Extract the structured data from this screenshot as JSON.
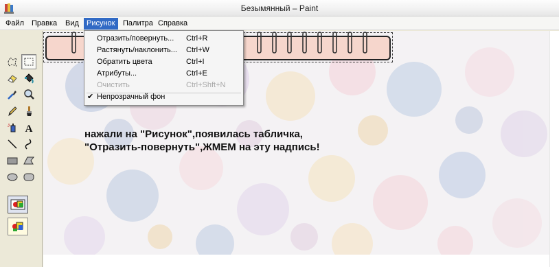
{
  "window": {
    "title": "Безымянный – Paint"
  },
  "menubar": {
    "items": [
      {
        "label": "Файл"
      },
      {
        "label": "Правка"
      },
      {
        "label": "Вид"
      },
      {
        "label": "Рисунок"
      },
      {
        "label": "Палитра"
      },
      {
        "label": "Справка"
      }
    ],
    "active_index": 3
  },
  "image_menu": {
    "items": [
      {
        "label": "Отразить/повернуть...",
        "shortcut": "Ctrl+R",
        "enabled": true
      },
      {
        "label": "Растянуть/наклонить...",
        "shortcut": "Ctrl+W",
        "enabled": true
      },
      {
        "label": "Обратить цвета",
        "shortcut": "Ctrl+I",
        "enabled": true
      },
      {
        "label": "Атрибуты...",
        "shortcut": "Ctrl+E",
        "enabled": true
      },
      {
        "label": "Очистить",
        "shortcut": "Ctrl+Shft+N",
        "enabled": false
      },
      {
        "label": "Непрозрачный фон",
        "shortcut": "",
        "enabled": true,
        "checked": true
      }
    ]
  },
  "toolbox": {
    "tools": [
      {
        "icon": "free-select-icon"
      },
      {
        "icon": "rect-select-icon",
        "selected": true
      },
      {
        "icon": "eraser-icon"
      },
      {
        "icon": "fill-bucket-icon"
      },
      {
        "icon": "color-picker-icon"
      },
      {
        "icon": "magnifier-icon"
      },
      {
        "icon": "pencil-icon"
      },
      {
        "icon": "brush-icon"
      },
      {
        "icon": "airbrush-icon"
      },
      {
        "icon": "text-icon",
        "glyph": "A"
      },
      {
        "icon": "line-icon"
      },
      {
        "icon": "curve-icon"
      },
      {
        "icon": "rectangle-icon"
      },
      {
        "icon": "polygon-icon"
      },
      {
        "icon": "ellipse-icon"
      },
      {
        "icon": "rounded-rectangle-icon"
      }
    ],
    "modes": [
      {
        "icon": "opaque-background-mode-icon",
        "selected": true
      },
      {
        "icon": "transparent-background-mode-icon",
        "selected": false
      }
    ]
  },
  "canvas": {
    "caption": "нажали на \"Рисунок\",появилась табличка, \"Отразить-повернуть\",ЖМЕМ на эту надпись!"
  },
  "colors": {
    "menu_highlight": "#316ac5",
    "notebook_fill": "#f6d6cc"
  }
}
